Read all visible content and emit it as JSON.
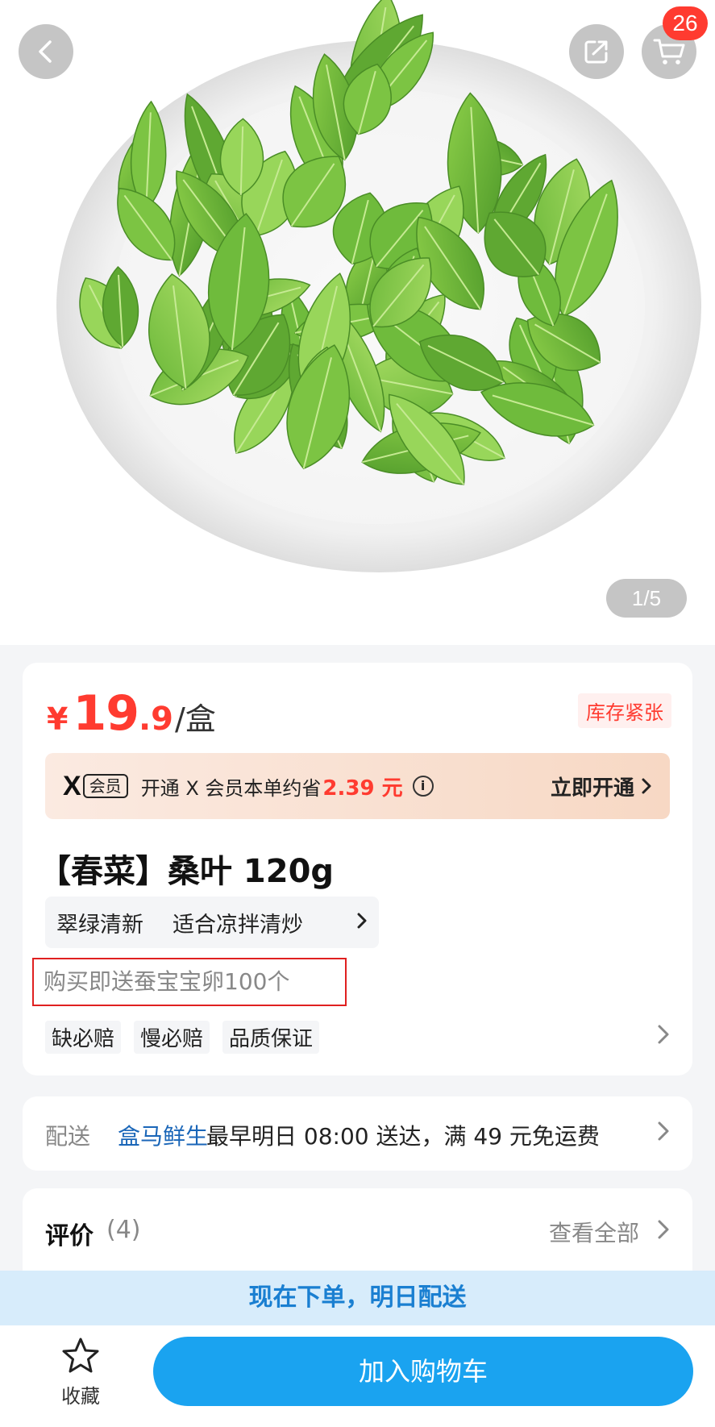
{
  "hero": {
    "cart_count": "26",
    "pager": "1/5"
  },
  "product": {
    "price": {
      "currency": "¥",
      "integer": "19",
      "decimal": ".9",
      "unit": "/盒"
    },
    "stock_tag": "库存紧张",
    "member": {
      "logo": "X",
      "tag": "会员",
      "text": "开通 X 会员本单约省",
      "savings": "2.39 元",
      "cta": "立即开通"
    },
    "title": "【春菜】桑叶 120g",
    "tags": [
      "翠绿清新",
      "适合凉拌清炒"
    ],
    "gift": "购买即送蚕宝宝卵100个",
    "guarantees": [
      "缺必赔",
      "慢必赔",
      "品质保证"
    ]
  },
  "delivery": {
    "label": "配送",
    "store": "盒马鲜生",
    "text": "最早明日 08:00 送达，满 49 元免运费"
  },
  "review": {
    "label": "评价",
    "count": "(4)",
    "see_all": "查看全部"
  },
  "banner": "现在下单，明日配送",
  "bottom": {
    "favorite_label": "收藏",
    "add_to_cart": "加入购物车"
  },
  "colors": {
    "price": "#ff3b30",
    "primary_button": "#1aa3f0",
    "banner_bg": "#d7ecfb",
    "highlight_border": "#e02020"
  }
}
